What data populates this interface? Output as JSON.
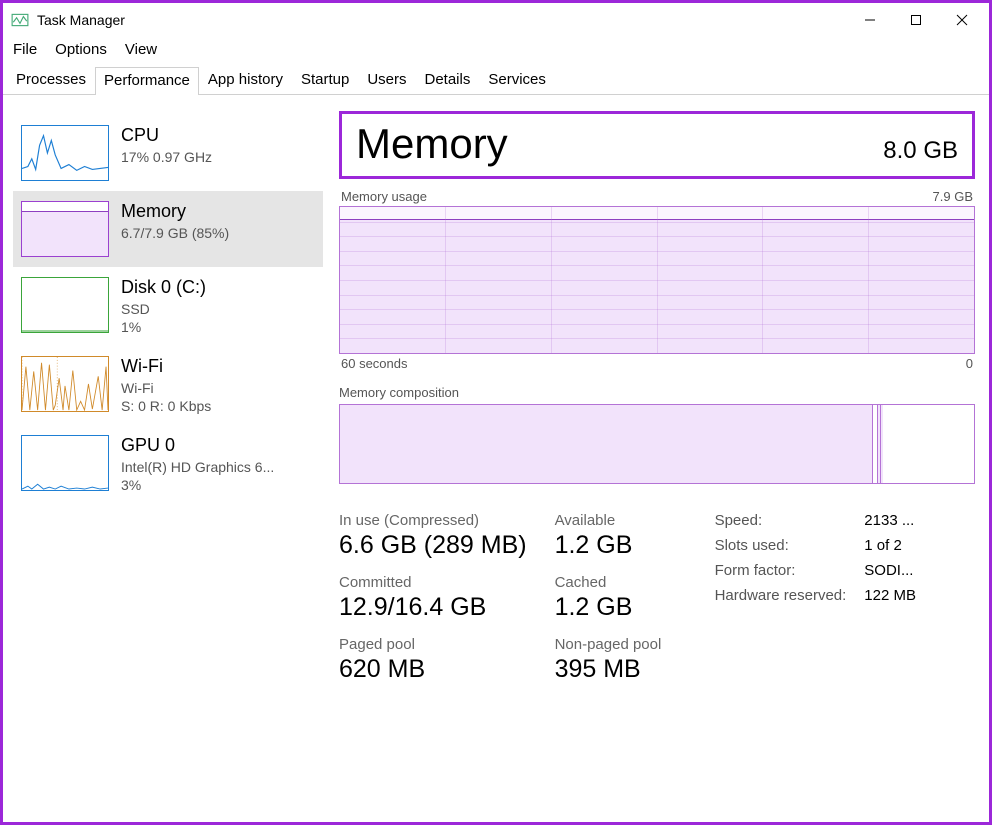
{
  "window": {
    "title": "Task Manager"
  },
  "menu": {
    "file": "File",
    "options": "Options",
    "view": "View"
  },
  "tabs": {
    "processes": "Processes",
    "performance": "Performance",
    "app_history": "App history",
    "startup": "Startup",
    "users": "Users",
    "details": "Details",
    "services": "Services"
  },
  "sidebar": {
    "cpu": {
      "title": "CPU",
      "sub1": "17%  0.97 GHz"
    },
    "mem": {
      "title": "Memory",
      "sub1": "6.7/7.9 GB (85%)"
    },
    "disk": {
      "title": "Disk 0 (C:)",
      "sub1": "SSD",
      "sub2": "1%"
    },
    "wifi": {
      "title": "Wi-Fi",
      "sub1": "Wi-Fi",
      "sub2": "S:  0  R:  0 Kbps"
    },
    "gpu": {
      "title": "GPU 0",
      "sub1": "Intel(R) HD Graphics 6...",
      "sub2": "3%"
    }
  },
  "main": {
    "title": "Memory",
    "total": "8.0 GB",
    "usage_label": "Memory usage",
    "usage_max": "7.9 GB",
    "x_left": "60 seconds",
    "x_right": "0",
    "composition_label": "Memory composition",
    "stats": {
      "in_use_label": "In use (Compressed)",
      "in_use": "6.6 GB (289 MB)",
      "available_label": "Available",
      "available": "1.2 GB",
      "committed_label": "Committed",
      "committed": "12.9/16.4 GB",
      "cached_label": "Cached",
      "cached": "1.2 GB",
      "paged_label": "Paged pool",
      "paged": "620 MB",
      "nonpaged_label": "Non-paged pool",
      "nonpaged": "395 MB"
    },
    "info": {
      "speed_label": "Speed:",
      "speed": "2133 ...",
      "slots_label": "Slots used:",
      "slots": "1 of 2",
      "form_label": "Form factor:",
      "form": "SODI...",
      "hw_label": "Hardware reserved:",
      "hw": "122 MB"
    }
  },
  "colors": {
    "cpu": "#1e7fd4",
    "mem": "#9b40d0",
    "disk": "#3aa53a",
    "net": "#d08a2a",
    "gpu": "#1e7fd4"
  },
  "chart_data": {
    "type": "line",
    "title": "Memory usage",
    "ylabel": "GB",
    "ylim": [
      0,
      7.9
    ],
    "x_span_seconds": 60,
    "series": [
      {
        "name": "Memory usage (GB)",
        "values": [
          6.7,
          6.7,
          6.7,
          6.7,
          6.7,
          6.7,
          6.7,
          6.7,
          6.7,
          6.7,
          6.7,
          6.7
        ]
      }
    ],
    "composition": {
      "in_use_gb": 6.6,
      "compressed_gb": 0.289,
      "available_gb": 1.2,
      "total_gb": 7.9
    }
  }
}
